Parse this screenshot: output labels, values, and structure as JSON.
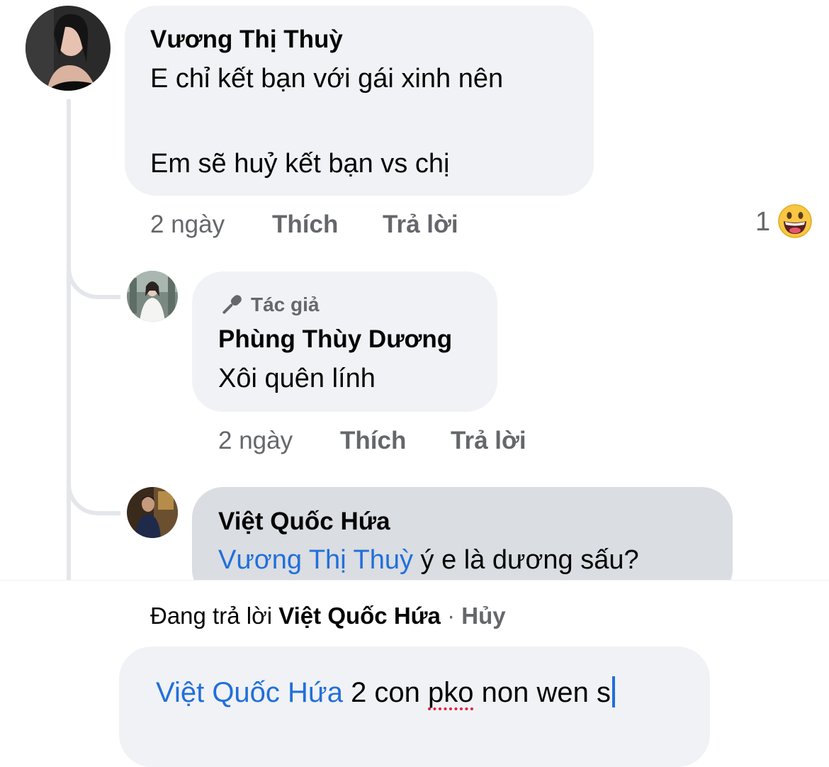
{
  "comments": [
    {
      "author": "Vương Thị Thuỳ",
      "lines": [
        "E chỉ kết bạn với gái xinh nên",
        "Em sẽ huỷ kết bạn vs chị"
      ],
      "time": "2 ngày",
      "like_label": "Thích",
      "reply_label": "Trả lời",
      "reaction_count": "1",
      "reaction_icon": "grinning-emoji-icon"
    },
    {
      "badge": "Tác giả",
      "badge_icon": "microphone-icon",
      "author": "Phùng Thùy Dương",
      "text": "Xôi quên lính",
      "time": "2 ngày",
      "like_label": "Thích",
      "reply_label": "Trả lời"
    },
    {
      "author": "Việt Quốc Hứa",
      "mention": "Vương Thị Thuỳ",
      "text": " ý e là dương sấu?"
    }
  ],
  "reply_bar": {
    "prefix": "Đang trả lời ",
    "target": "Việt Quốc Hứa",
    "separator": " · ",
    "cancel": "Hủy"
  },
  "composer": {
    "mention": "Việt Quốc Hứa",
    "text_before": " 2 con ",
    "misspelled": "pko",
    "text_after": " non wen s"
  },
  "colors": {
    "mention": "#216fdb",
    "bubble": "#f0f2f5",
    "bubble_pressed": "#dadde1",
    "meta": "#65676b"
  }
}
